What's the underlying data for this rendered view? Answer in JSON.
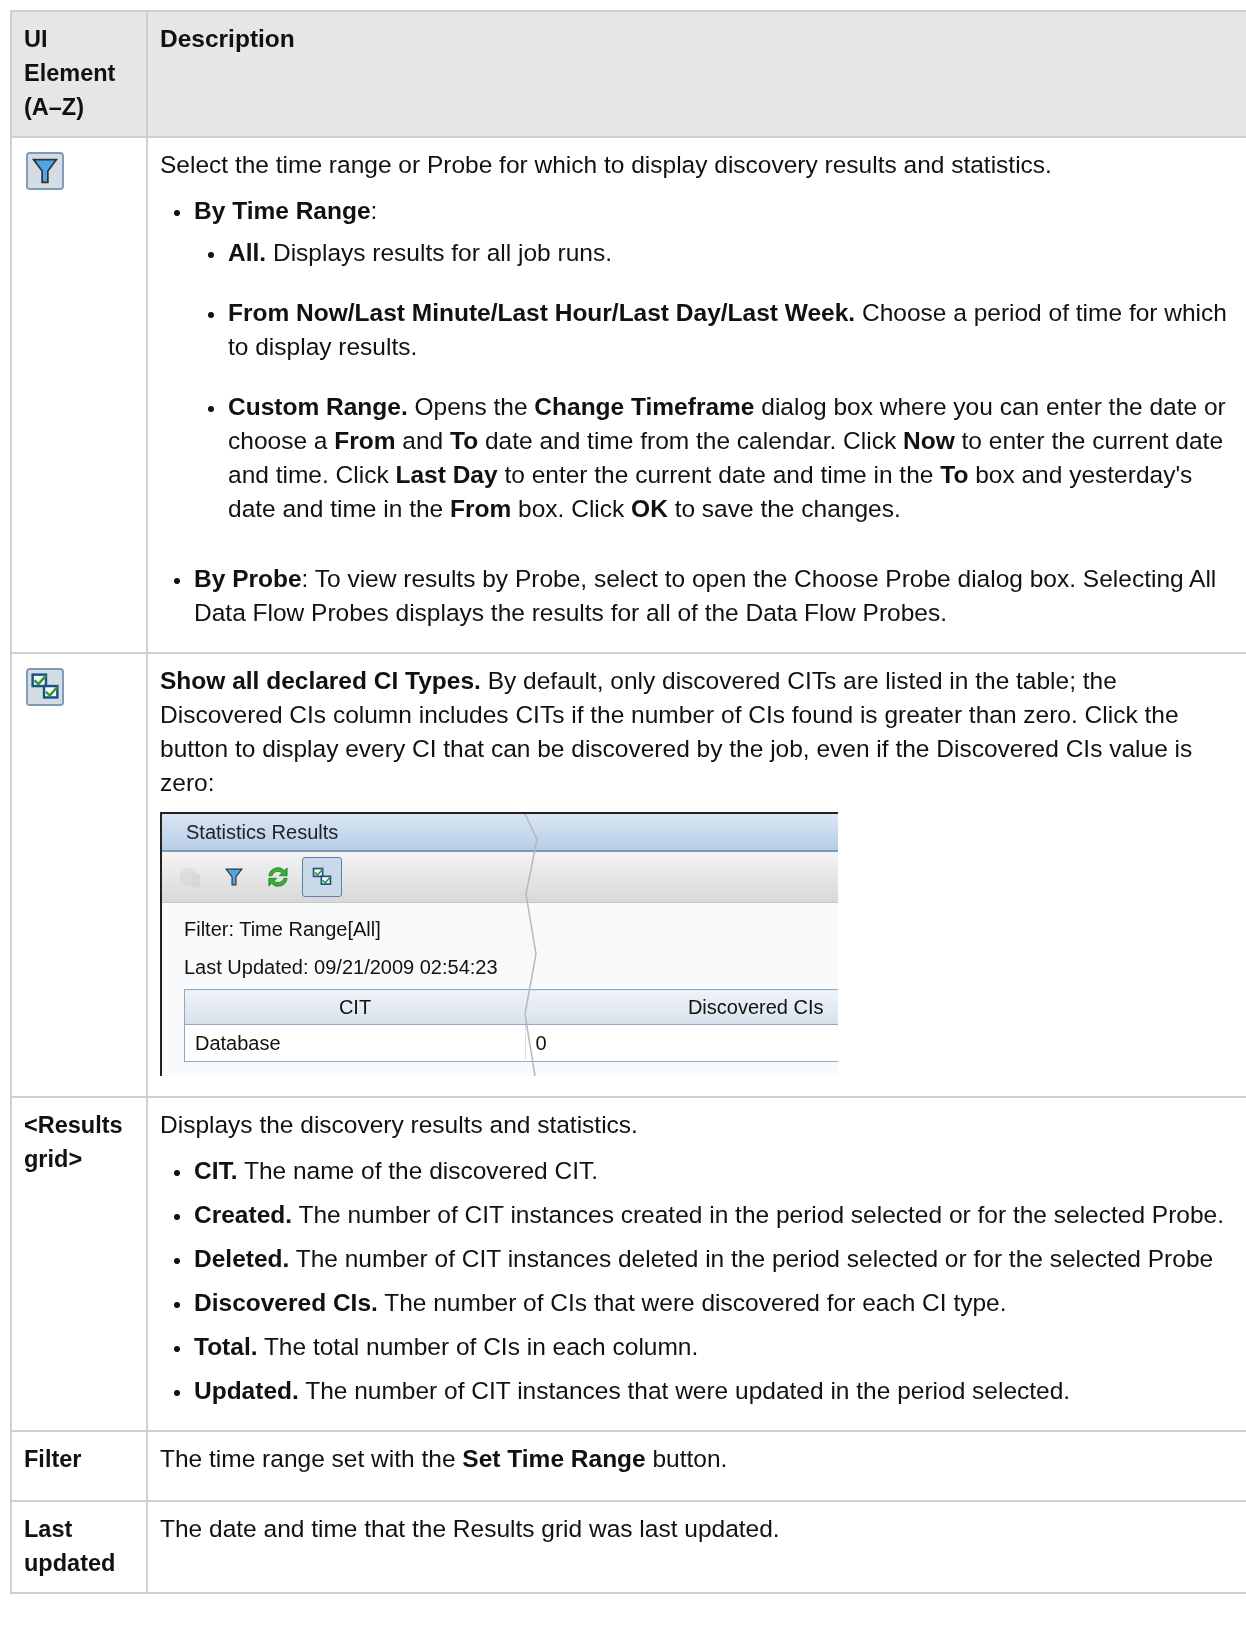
{
  "table": {
    "columns": [
      "UI Element (A–Z)",
      "Description"
    ],
    "rows": [
      {
        "element": {
          "kind": "filter"
        },
        "description": [
          {
            "kind": "paragraph",
            "text": "Select the time range or Probe for which to display discovery results and statistics."
          },
          {
            "kind": "list",
            "items": [
              {
                "text": "**By Time Range**:",
                "children": [
                  {
                    "text": "**All.** Displays results for all job runs."
                  },
                  {
                    "text": "**From Now/Last Minute/Last Hour/Last Day/Last Week.** Choose a period of time for which to display results."
                  },
                  {
                    "text": "**Custom Range.** Opens the **Change Timeframe** dialog box where you can enter the date or choose a **From** and **To** date and time from the calendar. Click **Now** to enter the current date and time. Click **Last Day** to enter the current date and time in the **To** box and yesterday's date and time in the **From** box. Click **OK** to save the changes."
                  }
                ]
              },
              {
                "text": "**By Probe**: To view results by Probe, select to open the Choose Probe dialog box. Selecting All Data Flow Probes displays the results for all of the Data Flow Probes."
              }
            ]
          }
        ]
      },
      {
        "element": {
          "kind": "show-all"
        },
        "description": [
          {
            "kind": "paragraph",
            "text": "**Show all declared CI Types.** By default, only discovered CITs are listed in the table; the Discovered CIs column includes CITs if the number of CIs found is greater than zero. Click the button to display every CI that can be discovered by the job, even if the Discovered CIs value is zero:"
          },
          {
            "kind": "screenshot",
            "title": "Statistics Results",
            "toolbar": [
              {
                "kind": "chart",
                "disabled": true,
                "selected": false
              },
              {
                "kind": "filter",
                "disabled": false,
                "selected": false
              },
              {
                "kind": "refresh",
                "disabled": false,
                "selected": false
              },
              {
                "kind": "show-all",
                "disabled": false,
                "selected": true
              }
            ],
            "filter": "Filter: Time Range[All]",
            "last_updated": "Last Updated: 09/21/2009 02:54:23",
            "columns": [
              "CIT",
              "Discovered CIs"
            ],
            "rows": [
              [
                "Database",
                "0"
              ]
            ]
          }
        ]
      },
      {
        "element": {
          "kind": "text",
          "text": "<Results grid>"
        },
        "description": [
          {
            "kind": "paragraph",
            "text": "Displays the discovery results and statistics."
          },
          {
            "kind": "list",
            "items": [
              {
                "text": "**CIT.** The name of the discovered CIT."
              },
              {
                "text": "**Created.** The number of CIT instances created in the period selected or for the selected Probe."
              },
              {
                "text": "**Deleted.** The number of CIT instances deleted in the period selected or for the selected Probe"
              },
              {
                "text": "**Discovered CIs.** The number of CIs that were discovered for each CI type."
              },
              {
                "text": "**Total.** The total number of CIs in each column."
              },
              {
                "text": "**Updated.** The number of CIT instances that were updated in the period selected."
              }
            ]
          }
        ]
      },
      {
        "element": {
          "kind": "text",
          "text": "Filter"
        },
        "description": [
          {
            "kind": "paragraph",
            "text": "The time range set with the **Set Time Range** button."
          }
        ]
      },
      {
        "element": {
          "kind": "text",
          "text": "Last updated"
        },
        "description": [
          {
            "kind": "paragraph",
            "text": "The date and time that the Results grid was last updated."
          }
        ]
      }
    ]
  }
}
